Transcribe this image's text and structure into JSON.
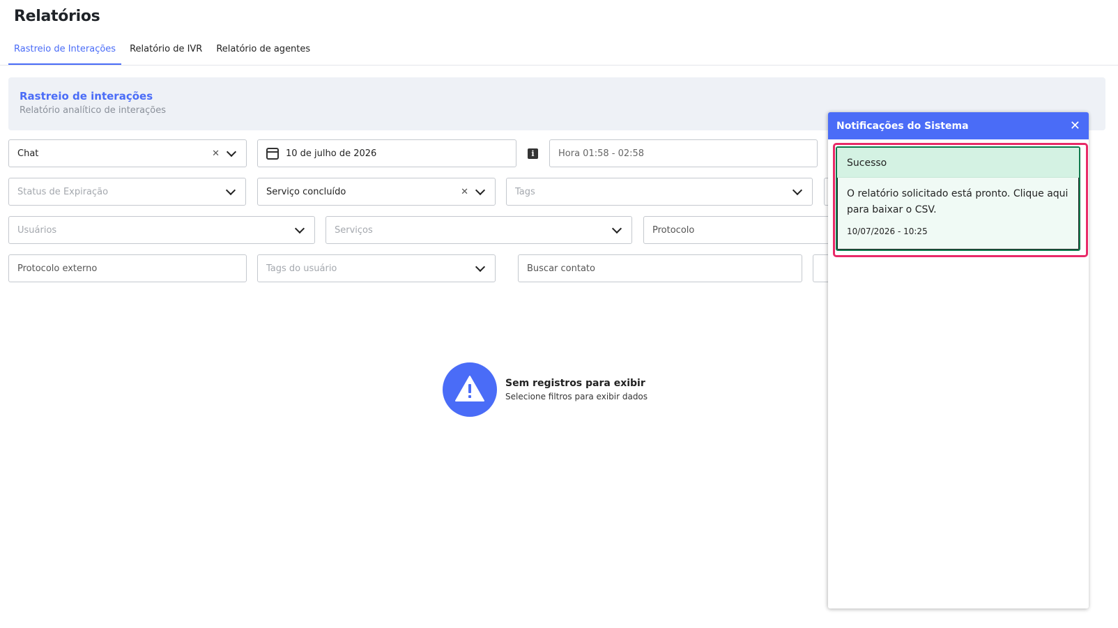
{
  "page": {
    "title": "Relatórios"
  },
  "tabs": [
    {
      "label": "Rastreio de Interações",
      "active": true
    },
    {
      "label": "Relatório de IVR",
      "active": false
    },
    {
      "label": "Relatório de agentes",
      "active": false
    }
  ],
  "banner": {
    "title": "Rastreio de interações",
    "subtitle": "Relatório analítico de interações"
  },
  "filters": {
    "channel": {
      "value": "Chat"
    },
    "date": {
      "value": "10 de julho de 2026"
    },
    "time": {
      "value": "Hora 01:58 - 02:58"
    },
    "expiration_status": {
      "placeholder": "Status de Expiração"
    },
    "service_status": {
      "value": "Serviço concluído"
    },
    "tags": {
      "placeholder": "Tags"
    },
    "users": {
      "placeholder": "Usuários"
    },
    "services": {
      "placeholder": "Serviços"
    },
    "protocol": {
      "placeholder": "Protocolo"
    },
    "external_protocol": {
      "placeholder": "Protocolo externo"
    },
    "user_tags": {
      "placeholder": "Tags do usuário"
    },
    "search_contact": {
      "placeholder": "Buscar contato"
    }
  },
  "empty_state": {
    "title": "Sem registros para exibir",
    "subtitle": "Selecione filtros para exibir dados",
    "icon": "warning-icon"
  },
  "notifications": {
    "title": "Notificações do Sistema",
    "items": [
      {
        "header": "Sucesso",
        "message": "O relatório solicitado está pronto. Clique aqui para baixar o CSV.",
        "date": "10/07/2026 - 10:25"
      }
    ]
  },
  "colors": {
    "accent": "#4a6cf7",
    "success_bg": "#d4f2e3",
    "highlight": "#e82a68"
  }
}
